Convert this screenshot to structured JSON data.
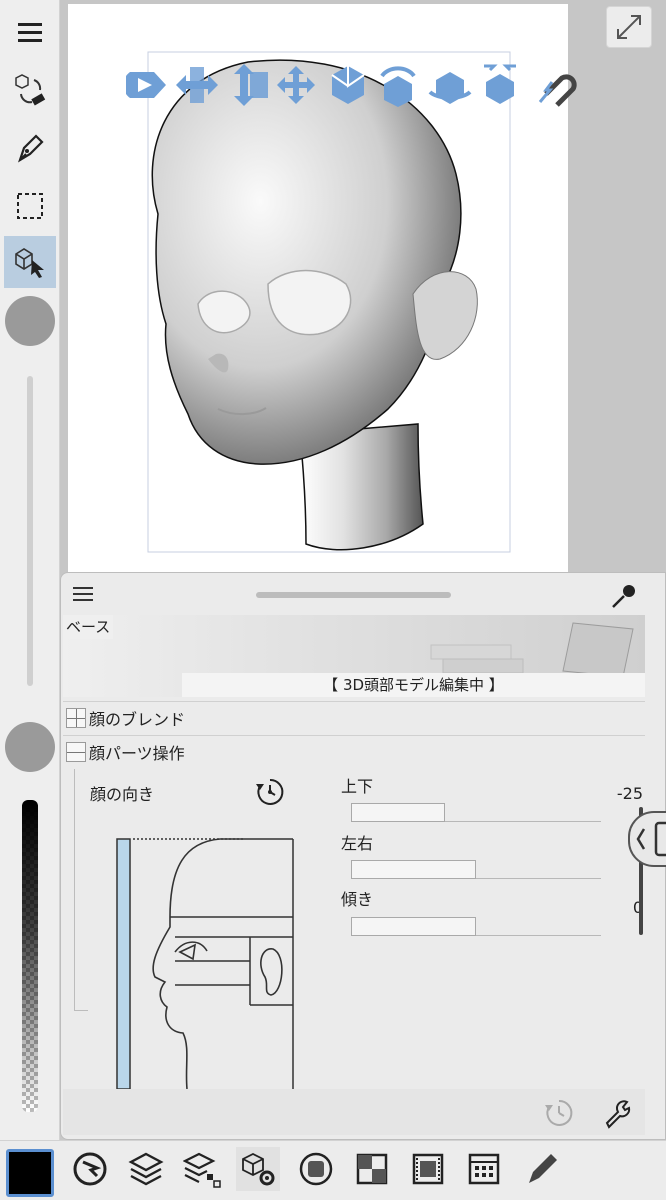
{
  "left_toolbar": {
    "tools": [
      {
        "icon": "menu-icon",
        "active": false
      },
      {
        "icon": "transform-eraser-icon",
        "active": false
      },
      {
        "icon": "pen-nib-icon",
        "active": false
      },
      {
        "icon": "selection-icon",
        "active": false
      },
      {
        "icon": "object-select-icon",
        "active": true
      }
    ],
    "brush_size_slider_value": 0.0,
    "opacity_slider_value": 1.0
  },
  "canvas": {
    "operation_icons": [
      "move-x-icon",
      "move-xy-icon",
      "move-z-icon",
      "rotate-free-icon",
      "rotate-x-icon",
      "rotate-y-icon",
      "rotate-z-icon",
      "scale-icon",
      "snap-magnet-icon"
    ],
    "accent_color": "#6f9fd6"
  },
  "panel": {
    "base_label": "ベース",
    "base_caption": "【 3D頭部モデル編集中 】",
    "sections": [
      {
        "title": "顔のブレンド",
        "expanded": false
      },
      {
        "title": "顔パーツ操作",
        "expanded": true
      }
    ],
    "direction_label": "顔の向き",
    "sliders": [
      {
        "label": "上下",
        "value": "-25",
        "fill": 0.375
      },
      {
        "label": "左右",
        "value": "0",
        "fill": 0.5
      },
      {
        "label": "傾き",
        "value": "0",
        "fill": 0.5
      }
    ]
  },
  "bottom_toolbar": {
    "color": "#000000",
    "icons": [
      "navigator-icon",
      "layers-icon",
      "layer-property-icon",
      "tool-property-icon",
      "sub-tool-icon",
      "material-icon",
      "animation-icon",
      "timeline-icon",
      "brush-icon"
    ]
  }
}
